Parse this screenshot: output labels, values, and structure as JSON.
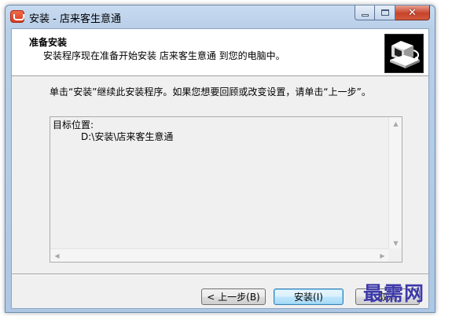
{
  "window": {
    "title": "安装 - 店来客生意通",
    "controls": {
      "minimize_icon": "minimize-icon",
      "maximize_icon": "maximize-icon",
      "close_glyph": "✕"
    }
  },
  "header": {
    "title": "准备安装",
    "subtitle": "安装程序现在准备开始安装 店来客生意通 到您的电脑中。",
    "logo_icon": "installer-computer-icon"
  },
  "body": {
    "message": "单击“安装”继续此安装程序。如果您想要回顾或改变设置，请单击“上一步”。",
    "memo": {
      "label": "目标位置:",
      "value": "D:\\安装\\店来客生意通"
    }
  },
  "buttons": {
    "back": "< 上一步(B)",
    "install": "安装(I)",
    "cancel": "取消"
  },
  "watermark": "最需网",
  "colors": {
    "titlebar": "#b9cfe8",
    "close_button": "#c7432a",
    "default_button_border": "#3c7fb1",
    "watermark": "#3d3aa8"
  }
}
